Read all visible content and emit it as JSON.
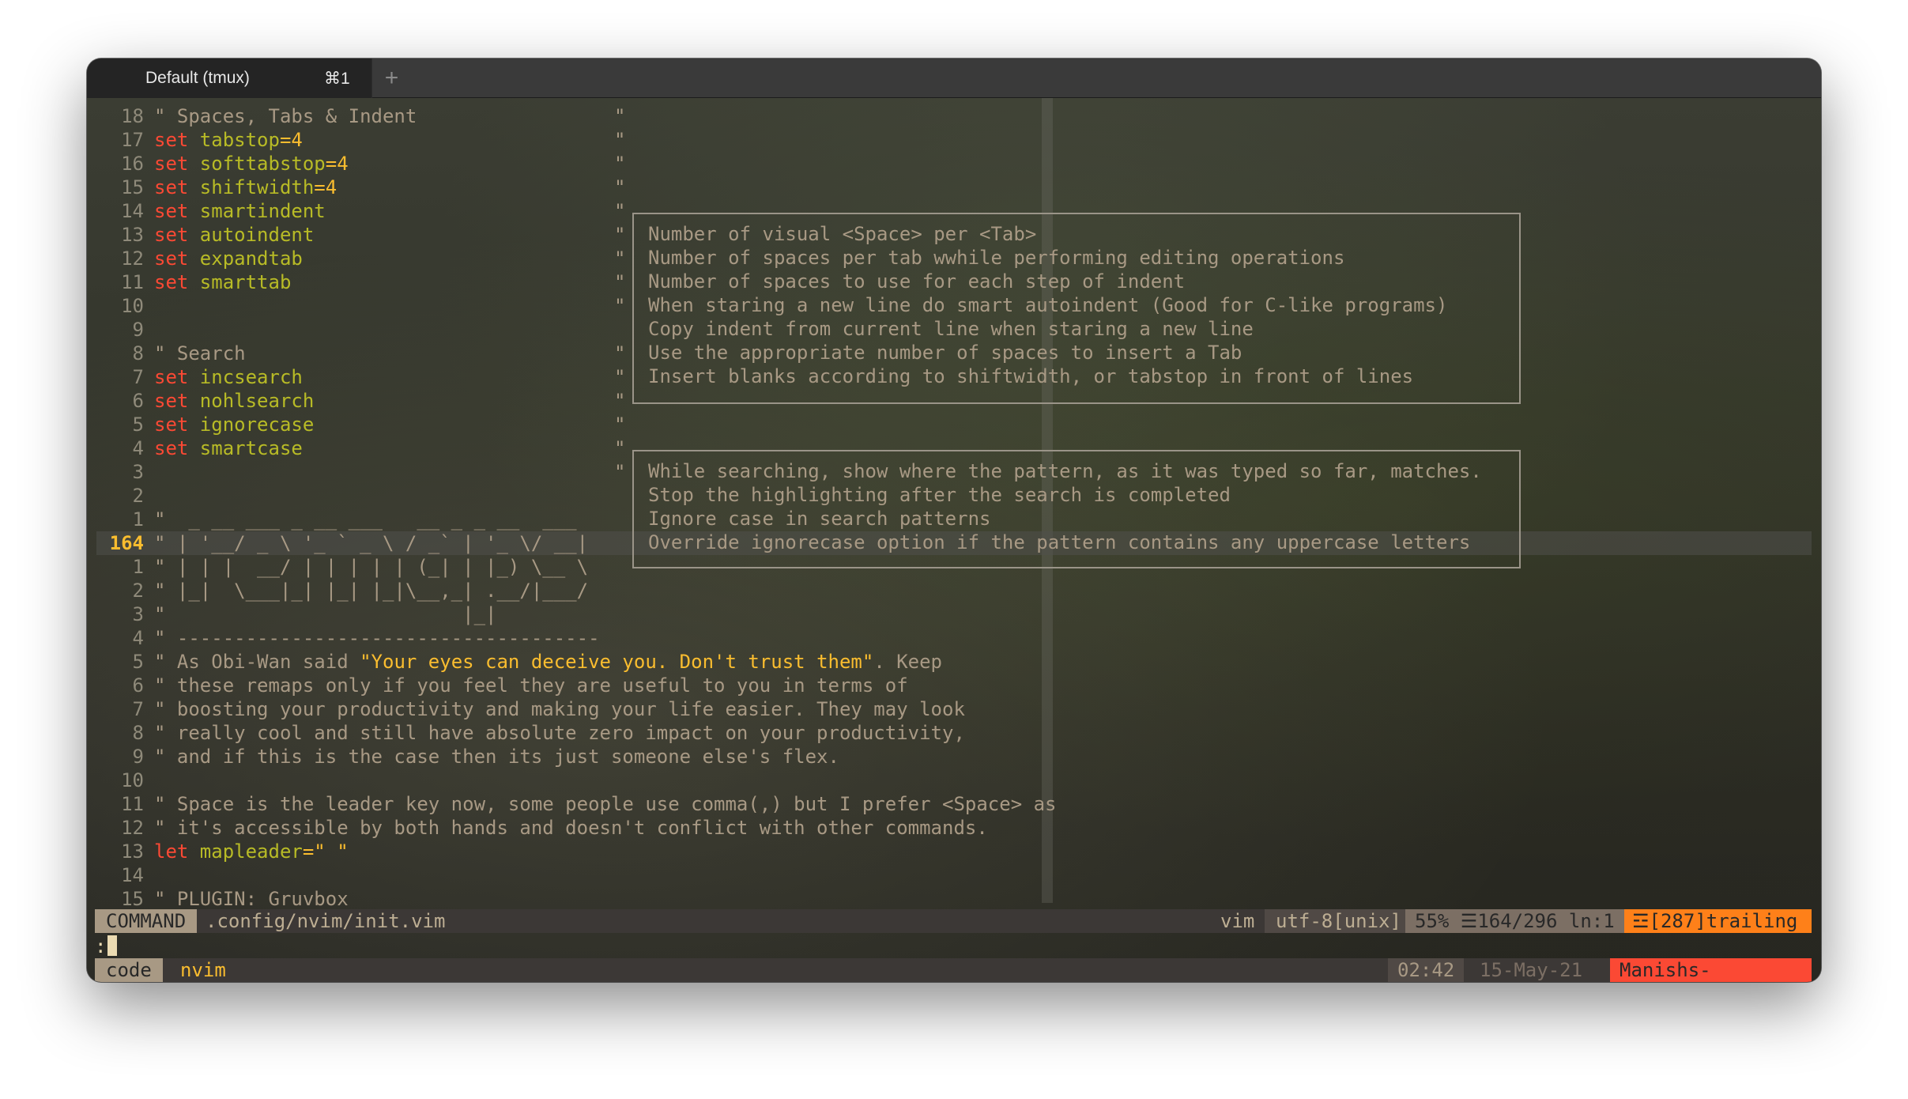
{
  "window": {
    "tab_title": "Default (tmux)",
    "tab_shortcut": "⌘1",
    "new_tab": "+"
  },
  "lines": [
    {
      "n": "18",
      "type": "comment",
      "text": "\" Spaces, Tabs & Indent",
      "q": true
    },
    {
      "n": "17",
      "type": "set",
      "opt": "tabstop",
      "val": "=4",
      "q": true
    },
    {
      "n": "16",
      "type": "set",
      "opt": "softtabstop",
      "val": "=4",
      "q": true
    },
    {
      "n": "15",
      "type": "set",
      "opt": "shiftwidth",
      "val": "=4",
      "q": true
    },
    {
      "n": "14",
      "type": "set",
      "opt": "smartindent",
      "val": "",
      "q": true
    },
    {
      "n": "13",
      "type": "set",
      "opt": "autoindent",
      "val": "",
      "q": true
    },
    {
      "n": "12",
      "type": "set",
      "opt": "expandtab",
      "val": "",
      "q": true
    },
    {
      "n": "11",
      "type": "set",
      "opt": "smarttab",
      "val": "",
      "q": true
    },
    {
      "n": "10",
      "type": "blank",
      "q": true
    },
    {
      "n": "9",
      "type": "blank",
      "q": false
    },
    {
      "n": "8",
      "type": "comment",
      "text": "\" Search",
      "q": true
    },
    {
      "n": "7",
      "type": "set",
      "opt": "incsearch",
      "val": "",
      "q": true
    },
    {
      "n": "6",
      "type": "set",
      "opt": "nohlsearch",
      "val": "",
      "q": true
    },
    {
      "n": "5",
      "type": "set",
      "opt": "ignorecase",
      "val": "",
      "q": true
    },
    {
      "n": "4",
      "type": "set",
      "opt": "smartcase",
      "val": "",
      "q": true
    },
    {
      "n": "3",
      "type": "blank",
      "q": true
    },
    {
      "n": "2",
      "type": "blank",
      "q": false
    },
    {
      "n": "1",
      "type": "art",
      "text": "\"  _ __ ___ _ __ ___   __ _ _ __  ___",
      "q": false
    },
    {
      "n": "164",
      "type": "art",
      "text": "\" | '__/ _ \\ '_ ` _ \\ / _` | '_ \\/ __|",
      "q": false,
      "current": true
    },
    {
      "n": "1",
      "type": "art",
      "text": "\" | | |  __/ | | | | | (_| | |_) \\__ \\",
      "q": false
    },
    {
      "n": "2",
      "type": "art",
      "text": "\" |_|  \\___|_| |_| |_|\\__,_| .__/|___/",
      "q": false
    },
    {
      "n": "3",
      "type": "art",
      "text": "\"                          |_|",
      "q": false
    },
    {
      "n": "4",
      "type": "art",
      "text": "\" -------------------------------------",
      "q": false
    },
    {
      "n": "5",
      "type": "quote",
      "pre": "\" As Obi-Wan said ",
      "str": "\"Your eyes can deceive you. Don't trust them\"",
      "post": ". Keep",
      "q": false
    },
    {
      "n": "6",
      "type": "comment",
      "text": "\" these remaps only if you feel they are useful to you in terms of",
      "q": false
    },
    {
      "n": "7",
      "type": "comment",
      "text": "\" boosting your productivity and making your life easier. They may look",
      "q": false
    },
    {
      "n": "8",
      "type": "comment",
      "text": "\" really cool and still have absolute zero impact on your productivity,",
      "q": false
    },
    {
      "n": "9",
      "type": "comment",
      "text": "\" and if this is the case then its just someone else's flex.",
      "q": false
    },
    {
      "n": "10",
      "type": "blank",
      "q": false
    },
    {
      "n": "11",
      "type": "comment",
      "text": "\" Space is the leader key now, some people use comma(,) but I prefer <Space> as",
      "q": false
    },
    {
      "n": "12",
      "type": "comment",
      "text": "\" it's accessible by both hands and doesn't conflict with other commands.",
      "q": false
    },
    {
      "n": "13",
      "type": "let",
      "opt": "mapleader",
      "val": "=\" \"",
      "q": false
    },
    {
      "n": "14",
      "type": "blank",
      "q": false
    },
    {
      "n": "15",
      "type": "comment",
      "text": "\" PLUGIN: Gruvbox",
      "q": false
    }
  ],
  "box1": [
    "Number of visual <Space> per <Tab>",
    "Number of spaces per tab wwhile performing editing operations",
    "Number of spaces to use for each step of indent",
    "When staring a new line do smart autoindent (Good for C-like programs)",
    "Copy indent from current line when staring a new line",
    "Use the appropriate number of spaces to insert a Tab",
    "Insert blanks according to shiftwidth, or tabstop in front of lines"
  ],
  "box2": [
    "While searching, show where the pattern, as it was typed so far, matches.",
    "Stop the highlighting after the search is completed",
    "Ignore case in search patterns",
    "Override ignorecase option if the pattern contains any uppercase letters"
  ],
  "statusline": {
    "mode": "COMMAND",
    "file": ".config/nvim/init.vim",
    "filetype": "vim",
    "encoding": "utf-8[unix]",
    "position": "55% ☰164/296 ln:1",
    "warning": "☲[287]trailing"
  },
  "cmdline": {
    "prompt": ":"
  },
  "tmux": {
    "session": "code",
    "window": "nvim",
    "time": "02:42",
    "date": "15-May-21",
    "host": "Manishs-MacBook-Pro"
  }
}
